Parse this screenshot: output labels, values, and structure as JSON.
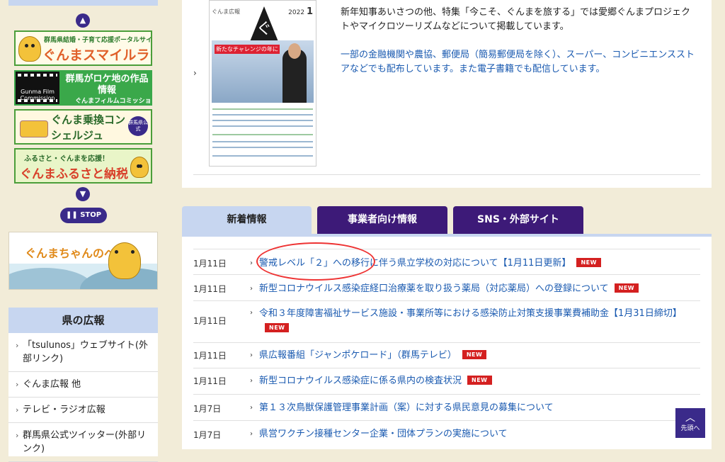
{
  "sidebar": {
    "banners": [
      {
        "small": "群馬県結婚・子育て応援ポータルサイト",
        "big": "ぐんまスマイルライフ"
      },
      {
        "big": "群馬がロケ地の作品情報",
        "small": "ぐんまフィルムコミッション",
        "film": "Gunma Film Commission"
      },
      {
        "big": "ぐんま乗換コンシェルジュ",
        "badge": "群馬県公式"
      },
      {
        "small": "ふるさと・ぐんまを応援！",
        "big": "ぐんまふるさと納税"
      }
    ],
    "stop_label": "STOP",
    "chan_banner": {
      "title_a": "ぐんまちゃん",
      "title_b": "のペ"
    },
    "koho": {
      "title": "県の広報",
      "items": [
        {
          "label": "「tsulunos」ウェブサイト(外部リンク)"
        },
        {
          "label": "ぐんま広報 他"
        },
        {
          "label": "テレビ・ラジオ広報"
        },
        {
          "label": "群馬県公式ツイッター(外部リンク)"
        }
      ]
    }
  },
  "magazine": {
    "title": "ぐんま広報",
    "year": "2022",
    "month": "1",
    "logo": "ぐ",
    "caption": "新たなチャレンジの年に"
  },
  "top_panel": {
    "desc1": "新年知事あいさつの他、特集「今こそ、ぐんまを旅する」では愛郷ぐんまプロジェクトやマイクロツーリズムなどについて掲載しています。",
    "desc2": "一部の金融機関や農協、郵便局（簡易郵便局を除く）、スーパー、コンビニエンスストアなどでも配布しています。また電子書籍でも配信しています。"
  },
  "tabs": [
    {
      "label": "新着情報"
    },
    {
      "label": "事業者向け情報"
    },
    {
      "label": "SNS・外部サイト"
    }
  ],
  "news": [
    {
      "date": "1月11日",
      "text": "警戒レベル「２」への移行に伴う県立学校の対応について【1月11日更新】",
      "new": "NEW"
    },
    {
      "date": "1月11日",
      "text": "新型コロナウイルス感染症経口治療薬を取り扱う薬局（対応薬局）への登録について",
      "new": "NEW"
    },
    {
      "date": "1月11日",
      "text": "令和３年度障害福祉サービス施設・事業所等における感染防止対策支援事業費補助金【1月31日締切】",
      "new": "NEW"
    },
    {
      "date": "1月11日",
      "text": "県広報番組「ジャンポケロード」（群馬テレビ）",
      "new": "NEW"
    },
    {
      "date": "1月11日",
      "text": "新型コロナウイルス感染症に係る県内の検査状況",
      "new": "NEW"
    },
    {
      "date": "1月7日",
      "text": "第１３次鳥獣保護管理事業計画（案）に対する県民意見の募集について",
      "new": ""
    },
    {
      "date": "1月7日",
      "text": "県営ワクチン接種センター企業・団体プランの実施について",
      "new": ""
    }
  ],
  "to_top": {
    "label": "先頭へ"
  },
  "colors": {
    "accent": "#3d1a78",
    "link": "#1a5ab0",
    "tab_active": "#c7d6f0",
    "new_badge": "#d42020",
    "background": "#f2ecd8"
  }
}
